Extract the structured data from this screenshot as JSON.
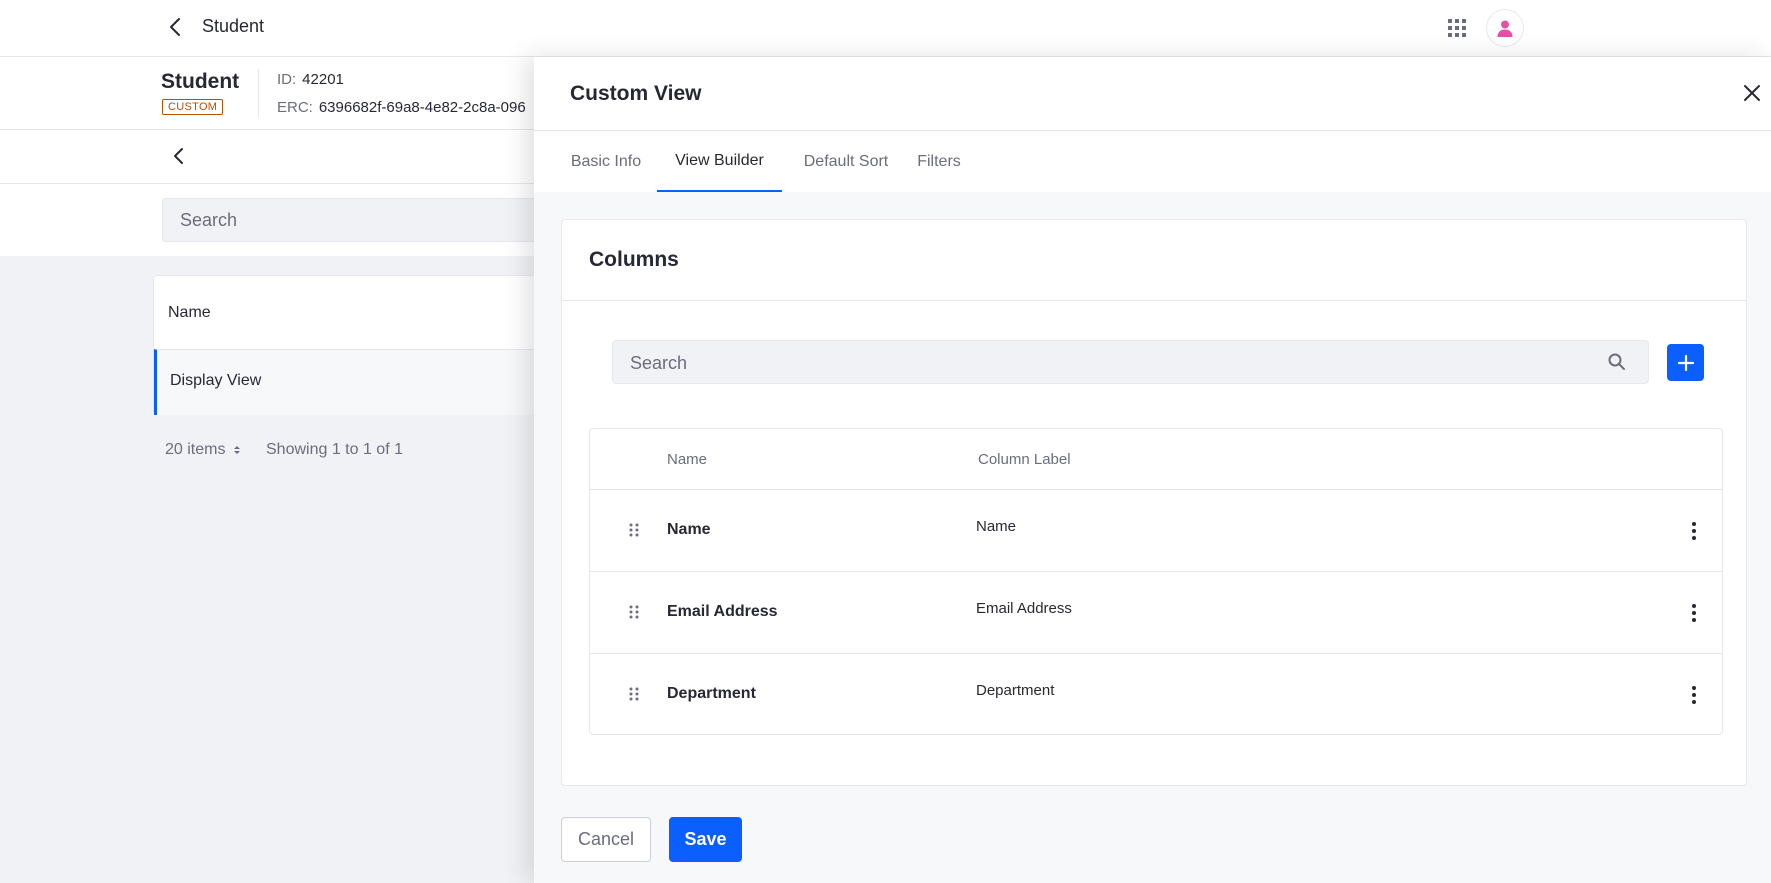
{
  "header": {
    "title": "Student"
  },
  "object_info": {
    "name": "Student",
    "badge": "CUSTOM",
    "id_label": "ID:",
    "id_value": "42201",
    "erc_label": "ERC:",
    "erc_value": "6396682f-69a8-4e82-2c8a-096"
  },
  "list": {
    "search_placeholder": "Search",
    "header": "Name",
    "rows": [
      "Display View"
    ],
    "pagination": {
      "per_page": "20 items",
      "showing": "Showing 1 to 1 of 1"
    }
  },
  "panel": {
    "title": "Custom View",
    "tabs": [
      {
        "label": "Basic Info",
        "active": false
      },
      {
        "label": "View Builder",
        "active": true
      },
      {
        "label": "Default Sort",
        "active": false
      },
      {
        "label": "Filters",
        "active": false
      }
    ],
    "columns_section": {
      "title": "Columns",
      "search_placeholder": "Search",
      "headers": {
        "name": "Name",
        "label": "Column Label"
      },
      "rows": [
        {
          "name": "Name",
          "label": "Name"
        },
        {
          "name": "Email Address",
          "label": "Email Address"
        },
        {
          "name": "Department",
          "label": "Department"
        }
      ]
    },
    "buttons": {
      "cancel": "Cancel",
      "save": "Save"
    }
  },
  "colors": {
    "primary": "#0b5fff",
    "accent_badge": "#b95000",
    "avatar": "#e64fa8"
  },
  "icons": [
    "back-icon",
    "apps-grid-icon",
    "user-avatar-icon",
    "close-icon",
    "search-icon",
    "plus-icon",
    "drag-handle-icon",
    "kebab-menu-icon",
    "sort-caret-icon"
  ]
}
